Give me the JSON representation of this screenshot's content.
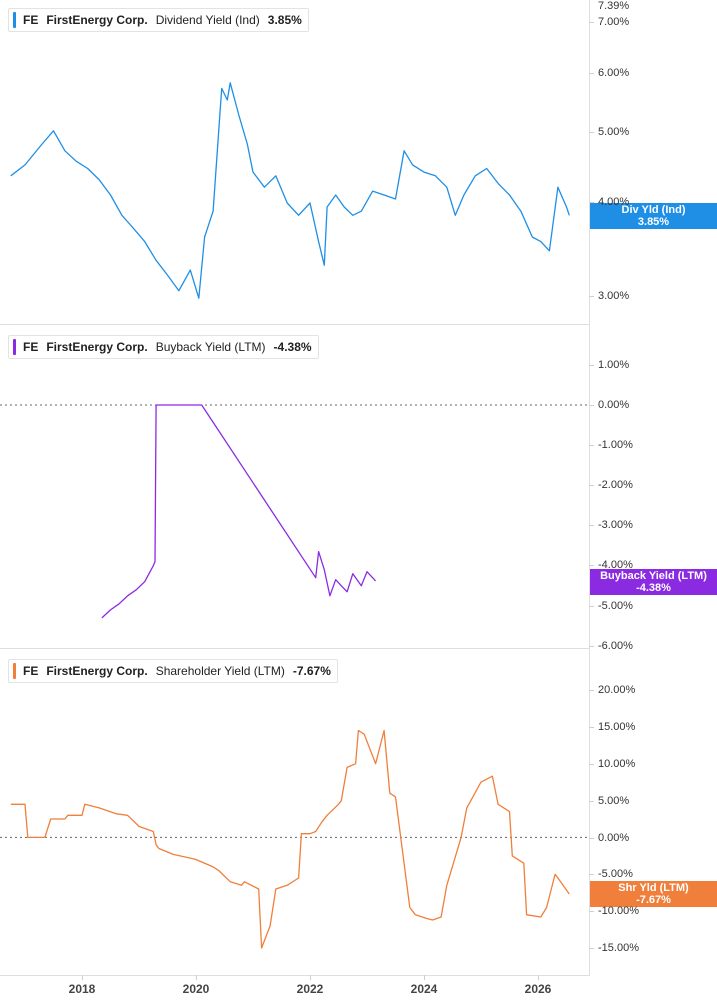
{
  "colors": {
    "dividend": "#1f8fe6",
    "buyback": "#8a2be2",
    "shareholder": "#f07f3c",
    "grid": "#dfdfdf",
    "zero_line": "#666666"
  },
  "x_axis": {
    "ticks": [
      "2018",
      "2020",
      "2022",
      "2024",
      "2026"
    ]
  },
  "panels": [
    {
      "id": "dividend",
      "legend": {
        "ticker": "FE",
        "company": "FirstEnergy Corp.",
        "metric": "Dividend Yield (Ind)",
        "value": "3.85%"
      },
      "flag": {
        "line1": "Div Yld (Ind)",
        "line2": "3.85%"
      },
      "y_ticks": [
        "7.39%",
        "7.00%",
        "6.00%",
        "5.00%",
        "4.00%",
        "3.00%"
      ]
    },
    {
      "id": "buyback",
      "legend": {
        "ticker": "FE",
        "company": "FirstEnergy Corp.",
        "metric": "Buyback Yield (LTM)",
        "value": "-4.38%"
      },
      "flag": {
        "line1": "Buyback Yield (LTM)",
        "line2": "-4.38%"
      },
      "y_ticks": [
        "1.00%",
        "0.00%",
        "-1.00%",
        "-2.00%",
        "-3.00%",
        "-4.00%",
        "-5.00%",
        "-6.00%"
      ]
    },
    {
      "id": "shareholder",
      "legend": {
        "ticker": "FE",
        "company": "FirstEnergy Corp.",
        "metric": "Shareholder Yield (LTM)",
        "value": "-7.67%"
      },
      "flag": {
        "line1": "Shr Yld (LTM)",
        "line2": "-7.67%"
      },
      "y_ticks": [
        "20.00%",
        "15.00%",
        "10.00%",
        "5.00%",
        "0.00%",
        "-5.00%",
        "-10.00%",
        "-15.00%"
      ]
    }
  ],
  "chart_data": [
    {
      "type": "line",
      "name": "Dividend Yield (Ind)",
      "yscale": "log",
      "ylim": [
        2.8,
        7.39
      ],
      "xlim": [
        2016.75,
        2026.95
      ],
      "series": [
        {
          "name": "Div Yld (Ind)",
          "x": [
            2016.75,
            2017.0,
            2017.3,
            2017.5,
            2017.7,
            2017.9,
            2018.1,
            2018.3,
            2018.5,
            2018.7,
            2018.9,
            2019.1,
            2019.3,
            2019.5,
            2019.7,
            2019.9,
            2020.05,
            2020.15,
            2020.3,
            2020.45,
            2020.55,
            2020.6,
            2020.75,
            2020.9,
            2021.0,
            2021.2,
            2021.4,
            2021.6,
            2021.8,
            2022.0,
            2022.15,
            2022.25,
            2022.3,
            2022.45,
            2022.6,
            2022.75,
            2022.9,
            2023.1,
            2023.3,
            2023.5,
            2023.65,
            2023.8,
            2024.0,
            2024.2,
            2024.4,
            2024.55,
            2024.7,
            2024.9,
            2025.1,
            2025.3,
            2025.5,
            2025.7,
            2025.9,
            2026.05,
            2026.2,
            2026.35,
            2026.5,
            2026.55
          ],
          "values": [
            4.35,
            4.5,
            4.8,
            5.0,
            4.7,
            4.55,
            4.45,
            4.3,
            4.1,
            3.85,
            3.7,
            3.55,
            3.35,
            3.2,
            3.05,
            3.25,
            2.98,
            3.6,
            3.9,
            5.7,
            5.5,
            5.8,
            5.25,
            4.8,
            4.4,
            4.2,
            4.35,
            4.0,
            3.85,
            4.0,
            3.55,
            3.3,
            3.95,
            4.1,
            3.95,
            3.85,
            3.9,
            4.15,
            4.1,
            4.05,
            4.7,
            4.5,
            4.4,
            4.35,
            4.2,
            3.85,
            4.1,
            4.35,
            4.45,
            4.25,
            4.1,
            3.9,
            3.6,
            3.55,
            3.45,
            4.2,
            3.95,
            3.85
          ]
        }
      ]
    },
    {
      "type": "line",
      "name": "Buyback Yield (LTM)",
      "ylim": [
        -6.0,
        1.0
      ],
      "xlim": [
        2016.75,
        2026.95
      ],
      "series": [
        {
          "name": "Buyback Yield (LTM)",
          "x": [
            2018.35,
            2018.5,
            2018.65,
            2018.8,
            2018.95,
            2019.1,
            2019.25,
            2019.28,
            2019.3,
            2020.1,
            2022.1,
            2022.15,
            2022.25,
            2022.35,
            2022.45,
            2022.55,
            2022.65,
            2022.75,
            2022.9,
            2023.0,
            2023.15
          ],
          "values": [
            -5.3,
            -5.1,
            -4.95,
            -4.75,
            -4.6,
            -4.4,
            -4.0,
            -3.9,
            0.0,
            0.0,
            -4.3,
            -3.65,
            -4.1,
            -4.75,
            -4.35,
            -4.5,
            -4.65,
            -4.2,
            -4.5,
            -4.15,
            -4.38
          ]
        }
      ]
    },
    {
      "type": "line",
      "name": "Shareholder Yield (LTM)",
      "ylim": [
        -16.0,
        21.0
      ],
      "xlim": [
        2016.75,
        2026.95
      ],
      "series": [
        {
          "name": "Shr Yld (LTM)",
          "x": [
            2016.75,
            2017.0,
            2017.05,
            2017.35,
            2017.45,
            2017.7,
            2017.75,
            2018.0,
            2018.05,
            2018.3,
            2018.6,
            2018.8,
            2019.0,
            2019.25,
            2019.3,
            2019.35,
            2019.6,
            2019.9,
            2020.0,
            2020.3,
            2020.4,
            2020.6,
            2020.8,
            2020.85,
            2021.1,
            2021.15,
            2021.3,
            2021.4,
            2021.6,
            2021.8,
            2021.85,
            2022.0,
            2022.1,
            2022.2,
            2022.3,
            2022.5,
            2022.55,
            2022.65,
            2022.8,
            2022.85,
            2022.95,
            2023.15,
            2023.3,
            2023.4,
            2023.5,
            2023.75,
            2023.85,
            2024.05,
            2024.15,
            2024.3,
            2024.4,
            2024.65,
            2024.75,
            2025.0,
            2025.2,
            2025.3,
            2025.5,
            2025.55,
            2025.75,
            2025.8,
            2026.05,
            2026.15,
            2026.3,
            2026.35,
            2026.55
          ],
          "values": [
            4.5,
            4.5,
            0.0,
            0.0,
            2.5,
            2.5,
            3.0,
            3.0,
            4.5,
            4.0,
            3.2,
            3.0,
            1.5,
            0.8,
            -1.0,
            -1.5,
            -2.3,
            -2.8,
            -3.0,
            -4.0,
            -4.5,
            -6.0,
            -6.5,
            -6.0,
            -7.0,
            -15.0,
            -12.0,
            -7.0,
            -6.5,
            -5.5,
            0.5,
            0.5,
            0.8,
            2.0,
            3.0,
            4.5,
            5.0,
            9.5,
            10.0,
            14.5,
            14.0,
            10.0,
            14.5,
            6.0,
            5.5,
            -9.5,
            -10.5,
            -11.0,
            -11.2,
            -10.8,
            -6.5,
            0.0,
            4.0,
            7.5,
            8.3,
            4.5,
            3.5,
            -2.5,
            -3.5,
            -10.5,
            -10.8,
            -9.5,
            -5.0,
            -5.5,
            -7.67
          ]
        }
      ]
    }
  ]
}
